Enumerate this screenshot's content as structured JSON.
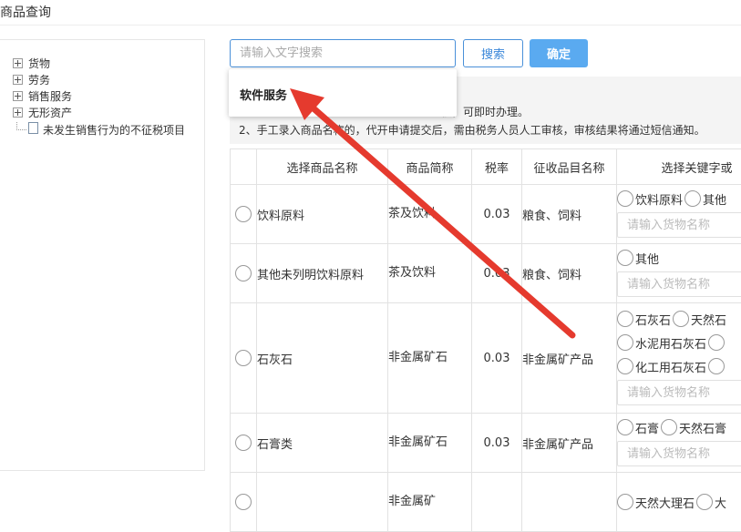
{
  "page": {
    "title": "商品查询"
  },
  "tree": {
    "items": [
      "货物",
      "劳务",
      "销售服务",
      "无形资产"
    ],
    "leaf": "未发生销售行为的不征税项目"
  },
  "search": {
    "placeholder": "请输入文字搜索",
    "search_label": "搜索",
    "confirm_label": "确定",
    "suggestion": "软件服务"
  },
  "notice": {
    "line1_tail": "核，可即时办理。",
    "line2": "2、手工录入商品名称的，代开申请提交后，需由税务人员人工审核，审核结果将通过短信通知。"
  },
  "table": {
    "headers": [
      "",
      "选择商品名称",
      "商品简称",
      "税率",
      "征收品目名称",
      "选择关键字或"
    ],
    "keyword_placeholder": "请输入货物名称",
    "rows": [
      {
        "name": "饮料原料",
        "abbr": "茶及饮料",
        "rate": "0.03",
        "category": "粮食、饲料",
        "keywords": [
          [
            "饮料原料",
            "其他"
          ]
        ]
      },
      {
        "name": "其他未列明饮料原料",
        "abbr": "茶及饮料",
        "rate": "0.03",
        "category": "粮食、饲料",
        "keywords": [
          [
            "其他"
          ]
        ]
      },
      {
        "name": "石灰石",
        "abbr": "非金属矿石",
        "rate": "0.03",
        "category": "非金属矿产品",
        "keywords": [
          [
            "石灰石",
            "天然石"
          ],
          [
            "水泥用石灰石",
            ""
          ],
          [
            "化工用石灰石",
            ""
          ]
        ]
      },
      {
        "name": "石膏类",
        "abbr": "非金属矿石",
        "rate": "0.03",
        "category": "非金属矿产品",
        "keywords": [
          [
            "石膏",
            "天然石膏"
          ]
        ]
      },
      {
        "name": "",
        "abbr": "非金属矿",
        "rate": "",
        "category": "",
        "keywords": [
          [
            "天然大理石",
            "大"
          ]
        ]
      }
    ]
  },
  "colors": {
    "accent": "#4a90d9",
    "button_primary": "#5aaaf0",
    "annotation_arrow": "#e53a2e"
  }
}
